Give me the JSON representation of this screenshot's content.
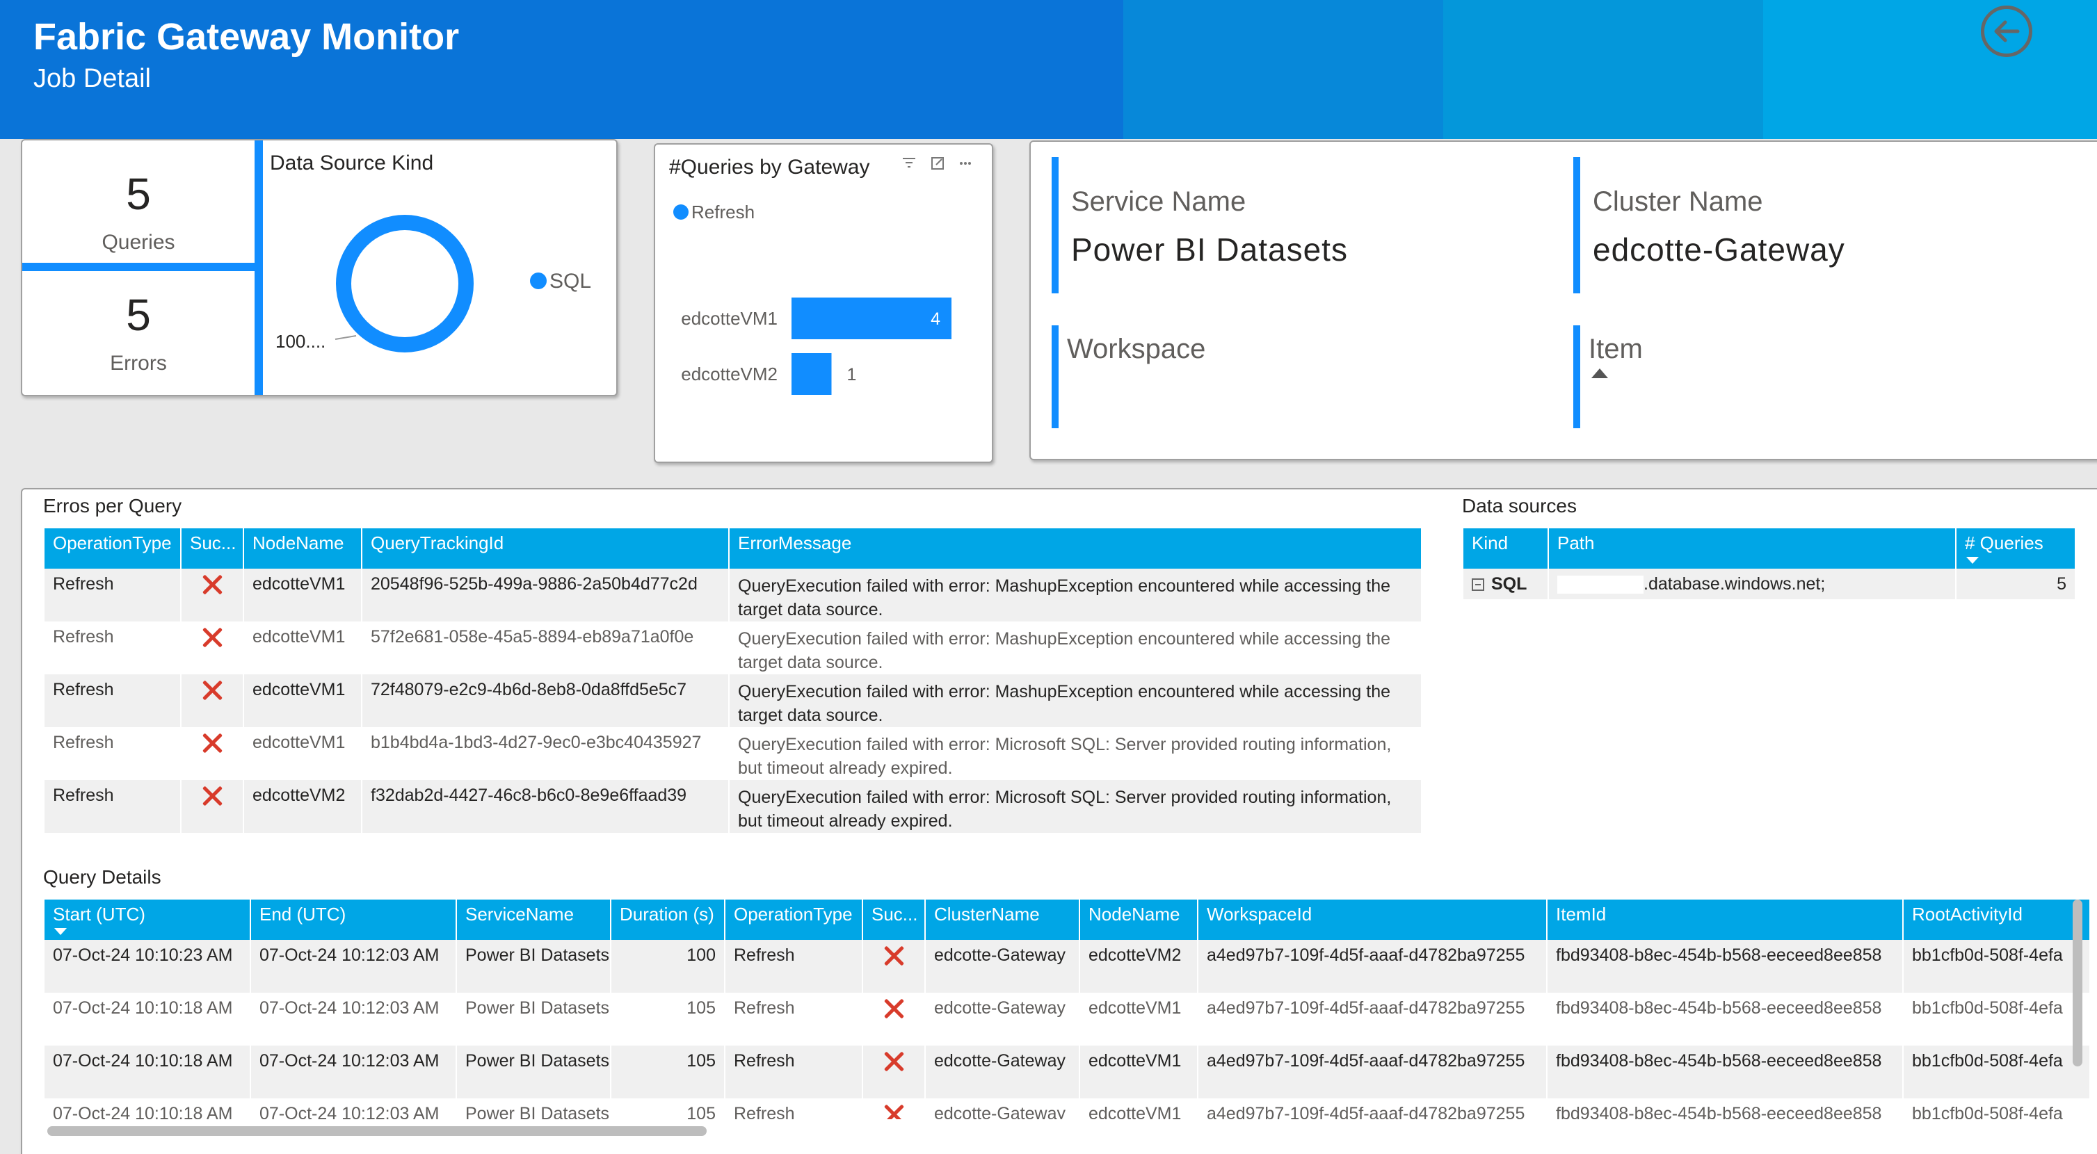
{
  "header": {
    "title": "Fabric Gateway Monitor",
    "subtitle": "Job Detail",
    "back_icon": "arrow-left-circle-icon"
  },
  "kpis": {
    "queries": {
      "value": "5",
      "label": "Queries"
    },
    "errors": {
      "value": "5",
      "label": "Errors"
    }
  },
  "datasource_kind": {
    "title": "Data Source Kind",
    "legend": "SQL",
    "slice_label": "100....",
    "chart_data": {
      "type": "pie",
      "categories": [
        "SQL"
      ],
      "values": [
        100
      ],
      "title": "Data Source Kind",
      "legend_position": "right"
    }
  },
  "queries_by_gateway": {
    "title": "#Queries by Gateway",
    "legend": "Refresh",
    "chart_data": {
      "type": "bar",
      "orientation": "horizontal",
      "title": "#Queries by Gateway",
      "categories": [
        "edcotteVM1",
        "edcotteVM2"
      ],
      "series": [
        {
          "name": "Refresh",
          "values": [
            4,
            1
          ]
        }
      ],
      "legend_position": "top-left"
    }
  },
  "cards": {
    "service_name": {
      "label": "Service Name",
      "value": "Power BI Datasets"
    },
    "cluster_name": {
      "label": "Cluster Name",
      "value": "edcotte-Gateway"
    },
    "workspace": {
      "label": "Workspace",
      "value": ""
    },
    "item": {
      "label": "Item",
      "value": ""
    }
  },
  "errors_table": {
    "title": "Erros per Query",
    "headers": [
      "OperationType",
      "Suc...",
      "NodeName",
      "QueryTrackingId",
      "ErrorMessage"
    ],
    "rows": [
      {
        "op": "Refresh",
        "node": "edcotteVM1",
        "id": "20548f96-525b-499a-9886-2a50b4d77c2d",
        "msg": "QueryExecution failed with error: MashupException encountered while accessing the target data source."
      },
      {
        "op": "Refresh",
        "node": "edcotteVM1",
        "id": "57f2e681-058e-45a5-8894-eb89a71a0f0e",
        "msg": "QueryExecution failed with error: MashupException encountered while accessing the target data source."
      },
      {
        "op": "Refresh",
        "node": "edcotteVM1",
        "id": "72f48079-e2c9-4b6d-8eb8-0da8ffd5e5c7",
        "msg": "QueryExecution failed with error: MashupException encountered while accessing the target data source."
      },
      {
        "op": "Refresh",
        "node": "edcotteVM1",
        "id": "b1b4bd4a-1bd3-4d27-9ec0-e3bc40435927",
        "msg": "QueryExecution failed with error: Microsoft SQL: Server provided routing information, but timeout already expired."
      },
      {
        "op": "Refresh",
        "node": "edcotteVM2",
        "id": "f32dab2d-4427-46c8-b6c0-8e9e6ffaad39",
        "msg": "QueryExecution failed with error: Microsoft SQL: Server provided routing information, but timeout already expired."
      }
    ]
  },
  "datasources_table": {
    "title": "Data sources",
    "headers": [
      "Kind",
      "Path",
      "# Queries"
    ],
    "rows": [
      {
        "kind": "SQL",
        "path": ".database.windows.net;",
        "queries": "5"
      }
    ]
  },
  "details_table": {
    "title": "Query Details",
    "headers": [
      "Start (UTC)",
      "End (UTC)",
      "ServiceName",
      "Duration (s)",
      "OperationType",
      "Suc...",
      "ClusterName",
      "NodeName",
      "WorkspaceId",
      "ItemId",
      "RootActivityId"
    ],
    "rows": [
      {
        "start": "07-Oct-24 10:10:23 AM",
        "end": "07-Oct-24 10:12:03 AM",
        "service": "Power BI Datasets",
        "duration": "100",
        "op": "Refresh",
        "cluster": "edcotte-Gateway",
        "node": "edcotteVM2",
        "ws": "a4ed97b7-109f-4d5f-aaaf-d4782ba97255",
        "item": "fbd93408-b8ec-454b-b568-eeceed8ee858",
        "root": "bb1cfb0d-508f-4efa"
      },
      {
        "start": "07-Oct-24 10:10:18 AM",
        "end": "07-Oct-24 10:12:03 AM",
        "service": "Power BI Datasets",
        "duration": "105",
        "op": "Refresh",
        "cluster": "edcotte-Gateway",
        "node": "edcotteVM1",
        "ws": "a4ed97b7-109f-4d5f-aaaf-d4782ba97255",
        "item": "fbd93408-b8ec-454b-b568-eeceed8ee858",
        "root": "bb1cfb0d-508f-4efa"
      },
      {
        "start": "07-Oct-24 10:10:18 AM",
        "end": "07-Oct-24 10:12:03 AM",
        "service": "Power BI Datasets",
        "duration": "105",
        "op": "Refresh",
        "cluster": "edcotte-Gateway",
        "node": "edcotteVM1",
        "ws": "a4ed97b7-109f-4d5f-aaaf-d4782ba97255",
        "item": "fbd93408-b8ec-454b-b568-eeceed8ee858",
        "root": "bb1cfb0d-508f-4efa"
      },
      {
        "start": "07-Oct-24 10:10:18 AM",
        "end": "07-Oct-24 10:12:03 AM",
        "service": "Power BI Datasets",
        "duration": "105",
        "op": "Refresh",
        "cluster": "edcotte-Gateway",
        "node": "edcotteVM1",
        "ws": "a4ed97b7-109f-4d5f-aaaf-d4782ba97255",
        "item": "fbd93408-b8ec-454b-b568-eeceed8ee858",
        "root": "bb1cfb0d-508f-4efa"
      }
    ]
  },
  "colors": {
    "header_blue": "#0a74d8",
    "accent": "#118dff",
    "table_header": "#00a6e6",
    "error_red": "#d83b2b"
  }
}
